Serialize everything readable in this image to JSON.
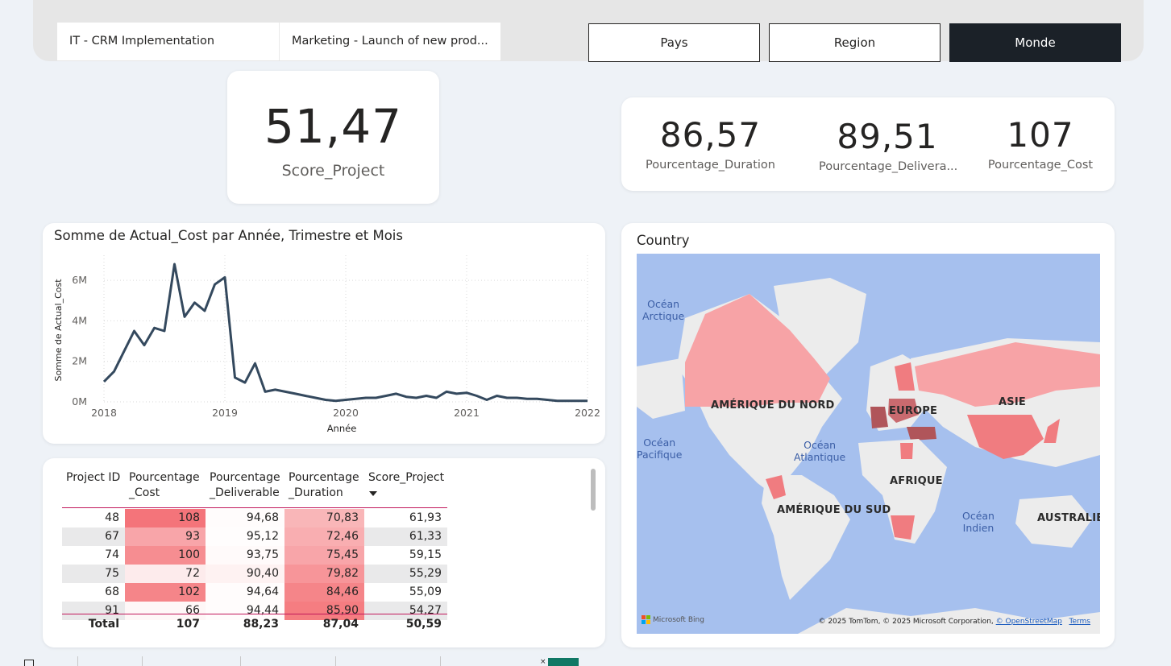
{
  "projects": [
    "IT - CRM Implementation",
    "Marketing - Launch of new prod..."
  ],
  "scope_buttons": {
    "pays": "Pays",
    "region": "Region",
    "monde": "Monde"
  },
  "score_card": {
    "value": "51,47",
    "label": "Score_Project"
  },
  "pct_cards": [
    {
      "value": "86,57",
      "label": "Pourcentage_Duration"
    },
    {
      "value": "89,51",
      "label": "Pourcentage_Delivera..."
    },
    {
      "value": "107",
      "label": "Pourcentage_Cost"
    }
  ],
  "colors": {
    "line": "#34495e",
    "accent_dark": "#1b2128",
    "heat_high": "#f25c62",
    "map_water": "#a6c0ee",
    "map_land": "#ececec",
    "map_country": "#f7a3a6"
  },
  "chart_data": {
    "type": "line",
    "title": "Somme de Actual_Cost par Année, Trimestre et Mois",
    "xlabel": "Année",
    "ylabel": "Somme de Actual_Cost",
    "x_ticks": [
      "2018",
      "2019",
      "2020",
      "2021",
      "2022"
    ],
    "y_ticks": [
      "6M",
      "4M",
      "2M",
      "0M"
    ],
    "xlim": [
      2018.0,
      2022.0
    ],
    "ylim": [
      0,
      7000000
    ],
    "grid": true,
    "series": [
      {
        "x": [
          2018.0,
          2018.083,
          2018.167,
          2018.25,
          2018.333,
          2018.417,
          2018.5,
          2018.583,
          2018.667,
          2018.75,
          2018.833,
          2018.917,
          2019.0,
          2019.083,
          2019.167,
          2019.25,
          2019.333,
          2019.417,
          2019.5,
          2019.583,
          2019.667,
          2019.75,
          2019.833,
          2019.917,
          2020.0,
          2020.083,
          2020.167,
          2020.25,
          2020.333,
          2020.417,
          2020.5,
          2020.583,
          2020.667,
          2020.75,
          2020.833,
          2020.917,
          2021.0,
          2021.083,
          2021.167,
          2021.25,
          2021.333,
          2021.417,
          2021.5,
          2021.583,
          2021.667,
          2021.75,
          2021.833,
          2021.917,
          2022.0
        ],
        "y": [
          1000000,
          1500000,
          2500000,
          3500000,
          2800000,
          3650000,
          3500000,
          6800000,
          4200000,
          4900000,
          4500000,
          5800000,
          6150000,
          1200000,
          950000,
          1900000,
          500000,
          600000,
          500000,
          400000,
          300000,
          200000,
          100000,
          50000,
          100000,
          150000,
          200000,
          200000,
          300000,
          400000,
          250000,
          200000,
          300000,
          200000,
          500000,
          400000,
          450000,
          300000,
          100000,
          300000,
          200000,
          200000,
          150000,
          150000,
          100000,
          50000,
          50000,
          50000,
          50000
        ]
      }
    ]
  },
  "table": {
    "headers": [
      [
        "Project ID"
      ],
      [
        "Pourcentage",
        "_Cost"
      ],
      [
        "Pourcentage",
        "_Deliverable"
      ],
      [
        "Pourcentage",
        "_Duration"
      ],
      [
        "Score_Project"
      ]
    ],
    "rows": [
      [
        "48",
        "108",
        "94,68",
        "70,83",
        "61,93"
      ],
      [
        "67",
        "93",
        "95,12",
        "72,46",
        "61,33"
      ],
      [
        "74",
        "100",
        "93,75",
        "75,45",
        "59,15"
      ],
      [
        "75",
        "72",
        "90,40",
        "79,82",
        "55,29"
      ],
      [
        "68",
        "102",
        "94,64",
        "84,46",
        "55,09"
      ],
      [
        "91",
        "66",
        "94,44",
        "85,90",
        "54,27"
      ]
    ],
    "cost_heat": [
      0.85,
      0.55,
      0.7,
      0.12,
      0.75,
      0.05
    ],
    "deliverable_heat": [
      0.02,
      0.01,
      0.03,
      0.08,
      0.02,
      0.02
    ],
    "duration_heat": [
      0.45,
      0.5,
      0.55,
      0.65,
      0.75,
      0.8
    ],
    "total": [
      "Total",
      "107",
      "88,23",
      "87,04",
      "50,59"
    ]
  },
  "map": {
    "title": "Country",
    "oceans": [
      {
        "text": "Océan\nArctique"
      },
      {
        "text": "Océan\nPacifique"
      },
      {
        "text": "Océan\nAtlantique"
      },
      {
        "text": "Océan\nIndien"
      }
    ],
    "regions": [
      "AMÉRIQUE DU NORD",
      "EUROPE",
      "ASIE",
      "AFRIQUE",
      "AMÉRIQUE DU SUD",
      "AUSTRALIE"
    ],
    "logo": "Microsoft Bing",
    "attribution": "© 2025 TomTom, © 2025 Microsoft Corporation,",
    "osm_link": "© OpenStreetMap",
    "terms_link": "Terms"
  }
}
